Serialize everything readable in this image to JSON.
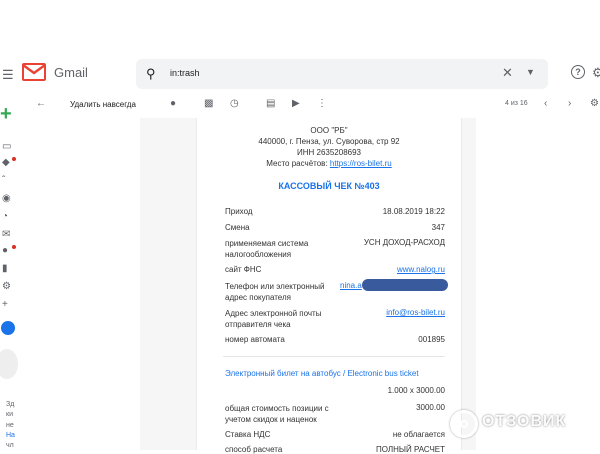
{
  "header": {
    "app_name": "Gmail",
    "search_value": "in:trash"
  },
  "toolbar": {
    "delete_forever_label": "Удалить навсегда",
    "counter": "4 из 16"
  },
  "sidebar": {
    "fragments": [
      "Зд",
      "ки",
      "не",
      "На",
      "чл"
    ]
  },
  "receipt": {
    "org": "ООО \"РБ\"",
    "address": "440000, г. Пенза, ул. Суворова, стр 92",
    "inn": "ИНН 2635208693",
    "settlement_label": "Место расчётов:",
    "settlement_link": "https://ros-bilet.ru",
    "title": "КАССОВЫЙ ЧЕК №403",
    "rows": [
      {
        "label": "Приход",
        "value": "18.08.2019 18:22"
      },
      {
        "label": "Смена",
        "value": "347"
      },
      {
        "label": "применяемая система налогообложения",
        "value": "УСН ДОХОД-РАСХОД"
      },
      {
        "label": "сайт ФНС",
        "value": "www.nalog.ru"
      },
      {
        "label": "Телефон или электронный адрес покупателя",
        "value": "nina.a"
      },
      {
        "label": "Адрес электронной почты отправителя чека",
        "value": "info@ros-bilet.ru"
      },
      {
        "label": "номер автомата",
        "value": "001895"
      }
    ],
    "ticket_title": "Электронный билет на автобус / Electronic bus ticket",
    "qty": "1.000 x 3000.00",
    "total_label": "общая стоимость позиции с учетом скидок и наценок",
    "total_value": "3000.00",
    "vat_label": "Ставка НДС",
    "vat_value": "не облагается",
    "last_label": "способ расчета",
    "last_value": "ПОЛНЫЙ РАСЧЕТ"
  },
  "watermark": "ОТЗОВИК",
  "colors": {
    "accent": "#1a73e8",
    "gmail_red": "#ea4335",
    "redaction": "#3a5a9e"
  }
}
